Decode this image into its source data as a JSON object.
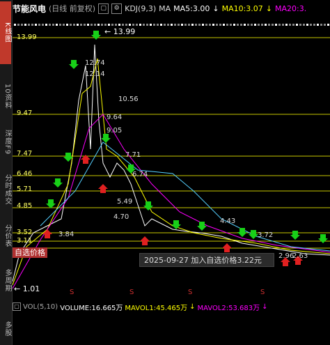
{
  "header": {
    "title": "节能风电",
    "period": "(日线 前复权)",
    "indicator": "KDJ(9,3)",
    "ma_label": "MA",
    "ma5": "MA5:3.00",
    "ma10": "MA10:3.07",
    "ma20": "MA20:3.",
    "colors": {
      "ma5": "#ffffff",
      "ma10": "#ffff00",
      "ma20": "#ff00ff"
    }
  },
  "sidebar": {
    "items": [
      {
        "label": "K线图",
        "active": true
      },
      {
        "label": "10资料",
        "active": false
      },
      {
        "label": "深度F9",
        "active": false
      },
      {
        "label": "分时成交",
        "active": false
      },
      {
        "label": "分价表",
        "active": false
      },
      {
        "label": "多周期",
        "active": false
      },
      {
        "label": "多股",
        "active": false
      }
    ]
  },
  "price_levels": [
    "13.99",
    "9.47",
    "7.47",
    "6.46",
    "5.71",
    "4.85",
    "3.52",
    "3.11"
  ],
  "annotations": {
    "high": "13.99",
    "low": "1.01",
    "watch_tag": "自选价格",
    "tooltip": "2025-09-27  加入自选价格3.22元"
  },
  "peak_labels": [
    "12.74",
    "12.14",
    "10.56",
    "9.64",
    "9.05",
    "7.71",
    "6.74",
    "5.49",
    "4.70",
    "4.43",
    "3.72",
    "3.84",
    "2.96",
    "2.63"
  ],
  "volume": {
    "label": "VOL(5,10)",
    "volume": "VOLUME:16.665万",
    "mavol1": "MAVOL1:45.465万",
    "mavol2": "MAVOL2:53.683万"
  },
  "signal_marker": "S"
}
